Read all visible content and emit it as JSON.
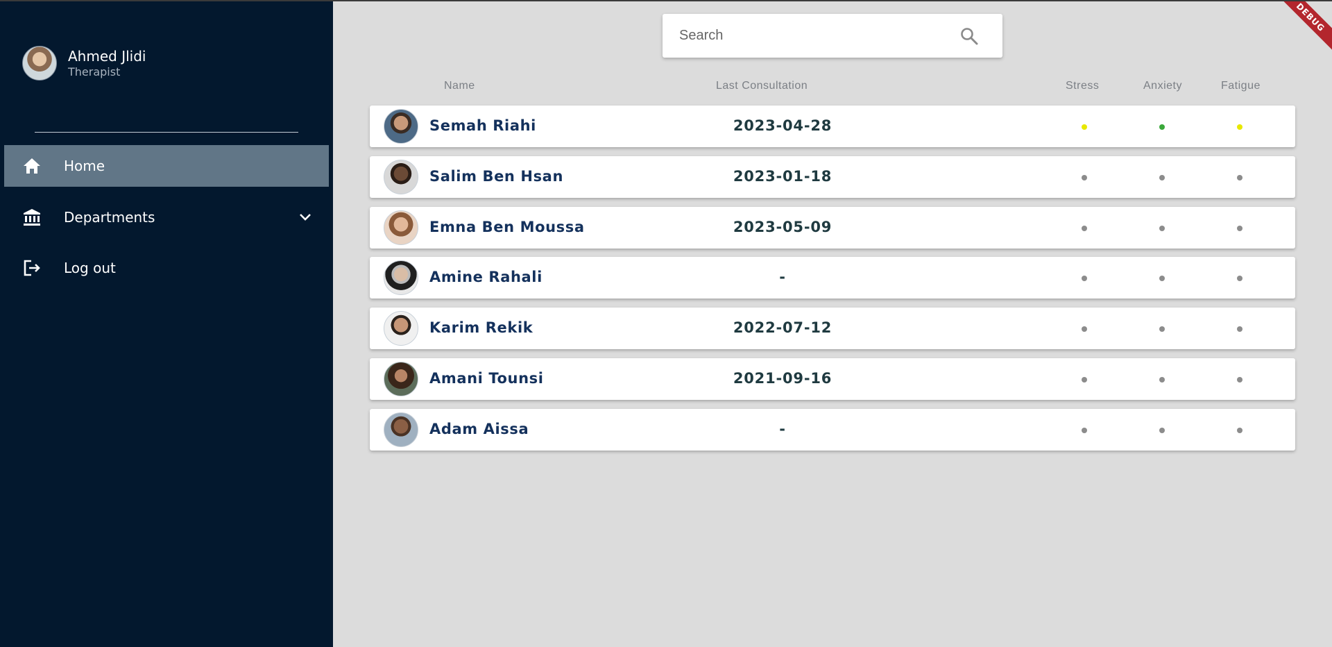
{
  "user": {
    "name": "Ahmed Jlidi",
    "role": "Therapist"
  },
  "nav": {
    "home": {
      "label": "Home",
      "icon": "home-icon"
    },
    "departments": {
      "label": "Departments",
      "icon": "bank-icon"
    },
    "logout": {
      "label": "Log out",
      "icon": "logout-icon"
    }
  },
  "search": {
    "placeholder": "Search"
  },
  "columns": {
    "name": "Name",
    "last_consultation": "Last Consultation",
    "stress": "Stress",
    "anxiety": "Anxiety",
    "fatigue": "Fatigue"
  },
  "patients": [
    {
      "name": "Semah Riahi",
      "last_consultation": "2023-04-28",
      "stress": "#e8e800",
      "anxiety": "#3aa83a",
      "fatigue": "#e8e800"
    },
    {
      "name": "Salim Ben Hsan",
      "last_consultation": "2023-01-18",
      "stress": "#8c8c8c",
      "anxiety": "#8c8c8c",
      "fatigue": "#8c8c8c"
    },
    {
      "name": "Emna Ben Moussa",
      "last_consultation": "2023-05-09",
      "stress": "#8c8c8c",
      "anxiety": "#8c8c8c",
      "fatigue": "#8c8c8c"
    },
    {
      "name": "Amine Rahali",
      "last_consultation": "-",
      "stress": "#8c8c8c",
      "anxiety": "#8c8c8c",
      "fatigue": "#8c8c8c"
    },
    {
      "name": "Karim Rekik",
      "last_consultation": "2022-07-12",
      "stress": "#8c8c8c",
      "anxiety": "#8c8c8c",
      "fatigue": "#8c8c8c"
    },
    {
      "name": "Amani Tounsi",
      "last_consultation": "2021-09-16",
      "stress": "#8c8c8c",
      "anxiety": "#8c8c8c",
      "fatigue": "#8c8c8c"
    },
    {
      "name": "Adam Aissa",
      "last_consultation": "-",
      "stress": "#8c8c8c",
      "anxiety": "#8c8c8c",
      "fatigue": "#8c8c8c"
    }
  ],
  "debug_banner": "DEBUG",
  "colors": {
    "sidebar": "#03182e",
    "active_nav": "#617687",
    "name_text": "#14315c",
    "background": "#dcdcdc"
  }
}
